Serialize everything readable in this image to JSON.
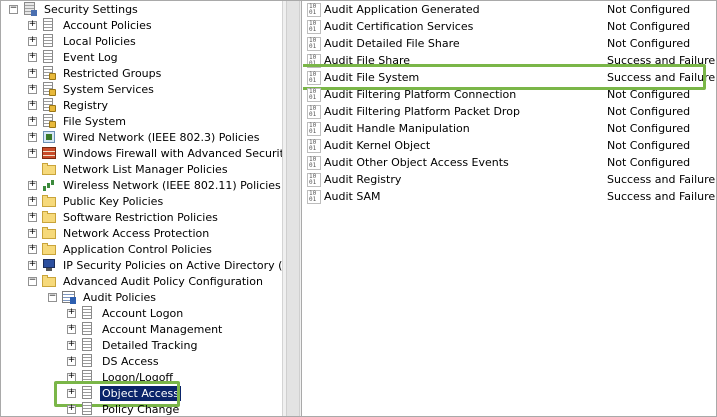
{
  "tree": {
    "items": [
      {
        "label": "Security Settings",
        "icon": "security-settings-icon",
        "expander": "minus",
        "level": 0
      },
      {
        "label": "Account Policies",
        "icon": "folder-doc-icon",
        "expander": "plus",
        "level": 1
      },
      {
        "label": "Local Policies",
        "icon": "folder-doc-icon",
        "expander": "plus",
        "level": 1
      },
      {
        "label": "Event Log",
        "icon": "folder-doc-icon",
        "expander": "plus",
        "level": 1
      },
      {
        "label": "Restricted Groups",
        "icon": "folder-lock-icon",
        "expander": "plus",
        "level": 1
      },
      {
        "label": "System Services",
        "icon": "folder-lock-icon",
        "expander": "plus",
        "level": 1
      },
      {
        "label": "Registry",
        "icon": "folder-lock-icon",
        "expander": "plus",
        "level": 1
      },
      {
        "label": "File System",
        "icon": "folder-lock-icon",
        "expander": "plus",
        "level": 1
      },
      {
        "label": "Wired Network (IEEE 802.3) Policies",
        "icon": "network-icon",
        "expander": "plus",
        "level": 1
      },
      {
        "label": "Windows Firewall with Advanced Security",
        "icon": "firewall-icon",
        "expander": "plus",
        "level": 1
      },
      {
        "label": "Network List Manager Policies",
        "icon": "folder-icon",
        "expander": "none",
        "level": 1
      },
      {
        "label": "Wireless Network (IEEE 802.11) Policies",
        "icon": "wireless-icon",
        "expander": "plus",
        "level": 1
      },
      {
        "label": "Public Key Policies",
        "icon": "folder-icon",
        "expander": "plus",
        "level": 1
      },
      {
        "label": "Software Restriction Policies",
        "icon": "folder-icon",
        "expander": "plus",
        "level": 1
      },
      {
        "label": "Network Access Protection",
        "icon": "folder-icon",
        "expander": "plus",
        "level": 1
      },
      {
        "label": "Application Control Policies",
        "icon": "folder-icon",
        "expander": "plus",
        "level": 1
      },
      {
        "label": "IP Security Policies on Active Directory (ROXX",
        "icon": "ip-security-icon",
        "expander": "plus",
        "level": 1
      },
      {
        "label": "Advanced Audit Policy Configuration",
        "icon": "folder-icon",
        "expander": "minus",
        "level": 1
      },
      {
        "label": "Audit Policies",
        "icon": "audit-policies-icon",
        "expander": "minus",
        "level": 2
      },
      {
        "label": "Account Logon",
        "icon": "policy-doc-icon",
        "expander": "plus",
        "level": 3
      },
      {
        "label": "Account Management",
        "icon": "policy-doc-icon",
        "expander": "plus",
        "level": 3
      },
      {
        "label": "Detailed Tracking",
        "icon": "policy-doc-icon",
        "expander": "plus",
        "level": 3
      },
      {
        "label": "DS Access",
        "icon": "policy-doc-icon",
        "expander": "plus",
        "level": 3
      },
      {
        "label": "Logon/Logoff",
        "icon": "policy-doc-icon",
        "expander": "plus",
        "level": 3
      },
      {
        "label": "Object Access",
        "icon": "policy-doc-icon",
        "expander": "plus",
        "level": 3,
        "selected": true
      },
      {
        "label": "Policy Change",
        "icon": "policy-doc-icon",
        "expander": "plus",
        "level": 3
      }
    ]
  },
  "list": {
    "rows": [
      {
        "name": "Audit Application Generated",
        "setting": "Not Configured"
      },
      {
        "name": "Audit Certification Services",
        "setting": "Not Configured"
      },
      {
        "name": "Audit Detailed File Share",
        "setting": "Not Configured"
      },
      {
        "name": "Audit File Share",
        "setting": "Success and Failure"
      },
      {
        "name": "Audit File System",
        "setting": "Success and Failure",
        "highlighted": true
      },
      {
        "name": "Audit Filtering Platform Connection",
        "setting": "Not Configured"
      },
      {
        "name": "Audit Filtering Platform Packet Drop",
        "setting": "Not Configured"
      },
      {
        "name": "Audit Handle Manipulation",
        "setting": "Not Configured"
      },
      {
        "name": "Audit Kernel Object",
        "setting": "Not Configured"
      },
      {
        "name": "Audit Other Object Access Events",
        "setting": "Not Configured"
      },
      {
        "name": "Audit Registry",
        "setting": "Success and Failure"
      },
      {
        "name": "Audit SAM",
        "setting": "Success and Failure"
      }
    ]
  },
  "colors": {
    "highlight_border": "#7ab648",
    "selection_bg": "#0a246a"
  }
}
